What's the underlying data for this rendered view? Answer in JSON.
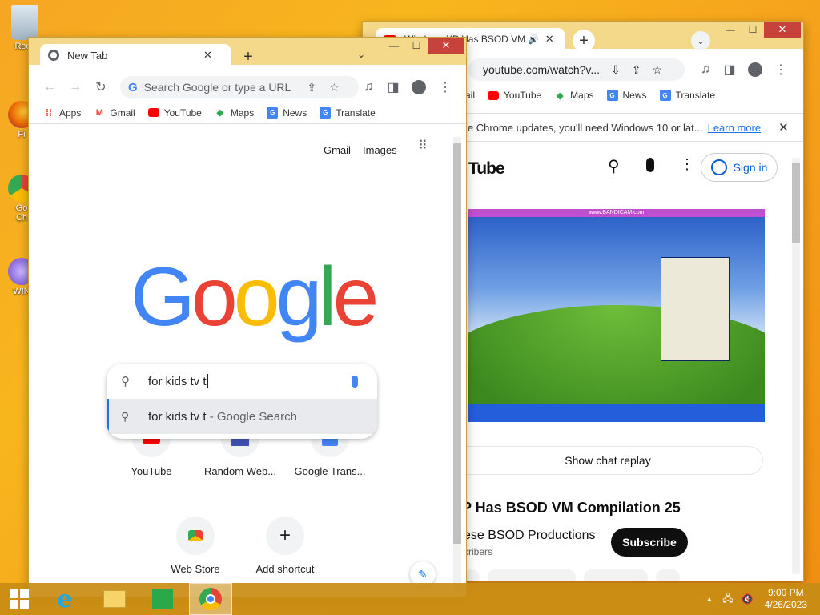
{
  "desktop": {
    "icons": [
      {
        "label": "Recy",
        "icon": "recycle-bin-icon"
      },
      {
        "label": "Fi",
        "icon": "firefox-icon"
      },
      {
        "label": "Go",
        "icon": "chrome-icon",
        "label2": "Ch"
      },
      {
        "label": "WIN",
        "icon": "app-icon"
      }
    ]
  },
  "left_window": {
    "tab_title": "New Tab",
    "omnibox_placeholder": "Search Google or type a URL",
    "bookmarks": [
      "Apps",
      "Gmail",
      "YouTube",
      "Maps",
      "News",
      "Translate"
    ],
    "header_links": [
      "Gmail",
      "Images"
    ],
    "logo": "Google",
    "search_value": "for kids tv t",
    "suggestion_query": "for kids tv t",
    "suggestion_suffix": " - Google Search",
    "shortcuts": [
      {
        "label": "YouTube",
        "icon": "youtube-icon"
      },
      {
        "label": "Random Web...",
        "icon": "random-web-icon"
      },
      {
        "label": "Google Trans...",
        "icon": "google-translate-icon"
      },
      {
        "label": "Web Store",
        "icon": "web-store-icon"
      },
      {
        "label": "Add shortcut",
        "icon": "plus-icon"
      }
    ]
  },
  "right_window": {
    "tab_title": "Windows XP Has BSOD VM",
    "url": "youtube.com/watch?v...",
    "bookmarks": [
      "ail",
      "YouTube",
      "Maps",
      "News",
      "Translate"
    ],
    "infobar_text": "le Chrome updates, you'll need Windows 10 or lat...",
    "infobar_link": "Learn more",
    "yt_logo": "Tube",
    "sign_in": "Sign in",
    "video_banner": "www.BANDICAM.com",
    "chat_replay": "Show chat replay",
    "video_title": "P Has BSOD VM Compilation 25",
    "channel": "ese BSOD Productions",
    "subscribers": "cribers",
    "subscribe": "Subscribe"
  },
  "taskbar": {
    "time": "9:00 PM",
    "date": "4/26/2023"
  },
  "colors": {
    "google_blue": "#4285F4",
    "google_red": "#EA4335",
    "google_yellow": "#FBBC05",
    "google_green": "#34A853"
  }
}
